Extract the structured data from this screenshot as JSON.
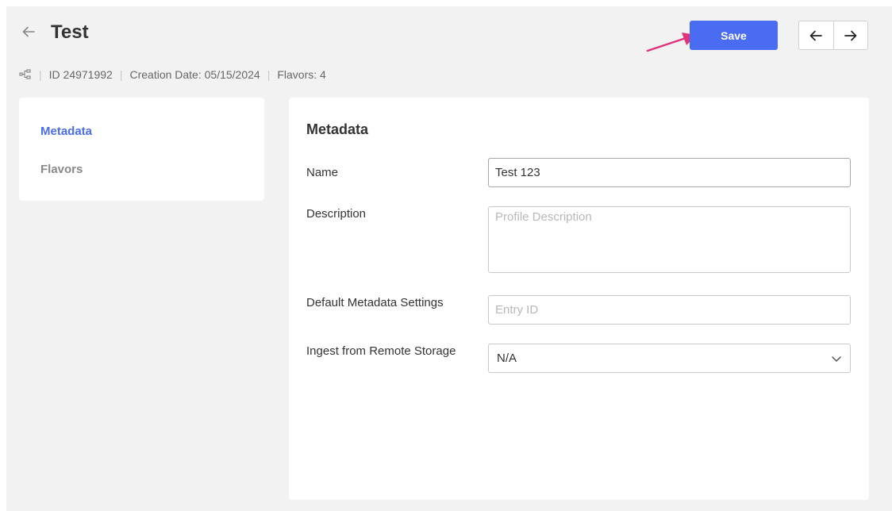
{
  "header": {
    "title": "Test",
    "save_label": "Save"
  },
  "subheader": {
    "id_text": "ID 24971992",
    "creation_date": "Creation Date: 05/15/2024",
    "flavors": "Flavors: 4"
  },
  "sidebar": {
    "items": [
      {
        "label": "Metadata",
        "active": true
      },
      {
        "label": "Flavors",
        "active": false
      }
    ]
  },
  "main": {
    "section_title": "Metadata",
    "fields": {
      "name": {
        "label": "Name",
        "value": "Test 123"
      },
      "description": {
        "label": "Description",
        "placeholder": "Profile Description"
      },
      "default_metadata": {
        "label": "Default Metadata Settings",
        "placeholder": "Entry ID"
      },
      "ingest_remote": {
        "label": "Ingest from Remote Storage",
        "value": "N/A"
      }
    }
  },
  "colors": {
    "accent": "#4a6cf0",
    "annotation_arrow": "#e0327a",
    "background": "#f2f2f2"
  },
  "icons": {
    "back": "arrow-left-icon",
    "prev": "arrow-left-icon",
    "next": "arrow-right-icon",
    "type": "flow-icon",
    "dropdown": "chevron-down-icon"
  }
}
